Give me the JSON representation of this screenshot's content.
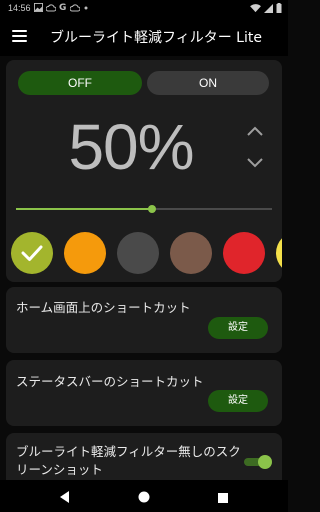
{
  "status_bar": {
    "time": "14:56",
    "left_icons": [
      "image-icon",
      "cloud-upload-icon",
      "google-icon",
      "cloud-upload-icon",
      "dot-icon"
    ],
    "right_icons": [
      "wifi-icon",
      "signal-icon",
      "battery-icon"
    ]
  },
  "app_bar": {
    "title": "ブルーライト軽減フィルター Lite",
    "menu_icon": "hamburger-menu-icon"
  },
  "filter": {
    "off_label": "OFF",
    "on_label": "ON",
    "selected_state": "OFF",
    "percent_text": "50%",
    "intensity_fraction": 0.53,
    "up_icon": "chevron-up-icon",
    "down_icon": "chevron-down-icon"
  },
  "swatches": [
    {
      "name": "olive",
      "color": "#a3b52d",
      "selected": true
    },
    {
      "name": "orange",
      "color": "#f59a0c",
      "selected": false
    },
    {
      "name": "gray",
      "color": "#4a4a4a",
      "selected": false
    },
    {
      "name": "brown",
      "color": "#7b5a4a",
      "selected": false
    },
    {
      "name": "red",
      "color": "#e0252b",
      "selected": false
    },
    {
      "name": "yellow",
      "color": "#f4e04a",
      "selected": false
    }
  ],
  "shortcuts": [
    {
      "label": "ホーム画面上のショートカット",
      "button_label": "設定"
    },
    {
      "label": "ステータスバーのショートカット",
      "button_label": "設定"
    }
  ],
  "screenshot_option": {
    "label": "ブルーライト軽減フィルター無しのスクリーンショット",
    "enabled": true
  },
  "colors": {
    "accent_green": "#8bc34a",
    "button_green": "#1e5a0f",
    "card_background": "#1d1d1d",
    "page_background": "#0a0a0a"
  },
  "nav_bar": {
    "icons": [
      "back-icon",
      "home-icon",
      "recents-icon"
    ]
  }
}
